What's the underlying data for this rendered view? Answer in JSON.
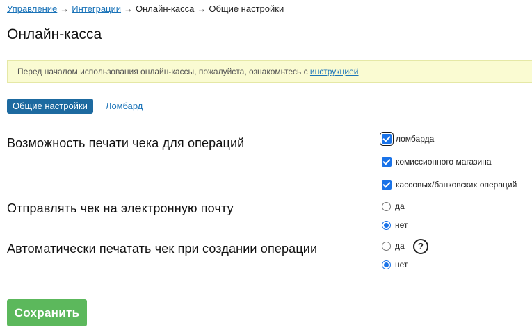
{
  "breadcrumb": {
    "items": [
      "Управление",
      "Интеграции",
      "Онлайн-касса",
      "Общие настройки"
    ],
    "separator": "→"
  },
  "page": {
    "title": "Онлайн-касса"
  },
  "notice": {
    "text": "Перед началом использования онлайн-кассы, пожалуйста, ознакомьтесь с",
    "link_text": "инструкцией"
  },
  "tabs": [
    {
      "label": "Общие настройки",
      "active": true
    },
    {
      "label": "Ломбард",
      "active": false
    }
  ],
  "settings": {
    "print_receipt": {
      "label": "Возможность печати чека для операций",
      "options": [
        {
          "label": "ломбарда",
          "checked": true
        },
        {
          "label": "комиссионного магазина",
          "checked": true
        },
        {
          "label": "кассовых/банковских операций",
          "checked": true
        }
      ]
    },
    "send_email": {
      "label": "Отправлять чек на электронную почту",
      "options": [
        {
          "label": "да",
          "selected": false
        },
        {
          "label": "нет",
          "selected": true
        }
      ]
    },
    "auto_print": {
      "label": "Автоматически печатать чек при создании операции",
      "options": [
        {
          "label": "да",
          "selected": false
        },
        {
          "label": "нет",
          "selected": true
        }
      ],
      "help_glyph": "?"
    }
  },
  "actions": {
    "save_label": "Сохранить"
  },
  "colors": {
    "link": "#1a73b8",
    "tab_active_bg": "#1d6aa0",
    "notice_bg": "#fafbd2",
    "control_accent": "#1a73e8",
    "save_bg": "#5cb85c"
  },
  "icons": {
    "help": "question-circle-icon",
    "checkbox": "checkmark-icon"
  }
}
